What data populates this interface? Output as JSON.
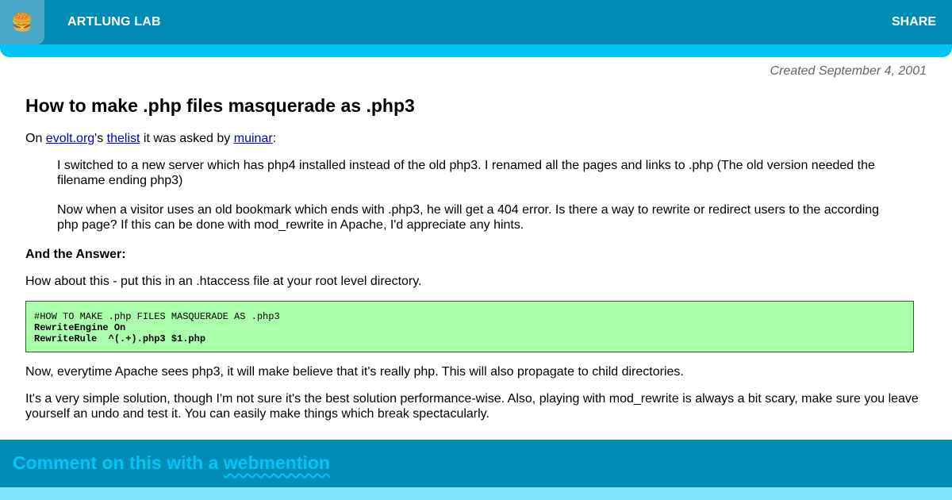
{
  "header": {
    "menu_icon": "🍔",
    "site_title": "ARTLUNG LAB",
    "share_label": "SHARE"
  },
  "meta": {
    "created": "Created September 4, 2001"
  },
  "article": {
    "title": "How to make .php files masquerade as .php3",
    "intro": {
      "prefix": "On ",
      "link1": "evolt.org",
      "mid1": "'s ",
      "link2": "thelist",
      "mid2": " it was asked by ",
      "link3": "muinar",
      "suffix": ":"
    },
    "quote": [
      "I switched to a new server which has php4 installed instead of the old php3. I renamed all the pages and links to .php (The old version needed the filename ending php3)",
      "Now when a visitor uses an old bookmark which ends with .php3, he will get a 404 error. Is there a way to rewrite or redirect users to the according php page? If this can be done with mod_rewrite in Apache, I'd appreciate any hints."
    ],
    "answer_heading": "And the Answer:",
    "answer_intro": "How about this - put this in an .htaccess file at your root level directory.",
    "code": [
      "#HOW TO MAKE .php FILES MASQUERADE AS .php3",
      "RewriteEngine On",
      "RewriteRule  ^(.+).php3 $1.php"
    ],
    "para1": "Now, everytime Apache sees php3, it will make believe that it's really php. This will also propagate to child directories.",
    "para2": "It's a very simple solution, though I'm not sure it's the best solution performance-wise. Also, playing with mod_rewrite is always a bit scary, make sure you leave yourself an undo and test it. You can easily make things which break spectacularly."
  },
  "footer": {
    "title_prefix": "Comment on this with a ",
    "title_link": "webmention"
  },
  "colors": {
    "header_bg": "#018cb6",
    "accent": "#00c5f5",
    "code_bg": "#aaffaa",
    "link": "#0000cc"
  }
}
